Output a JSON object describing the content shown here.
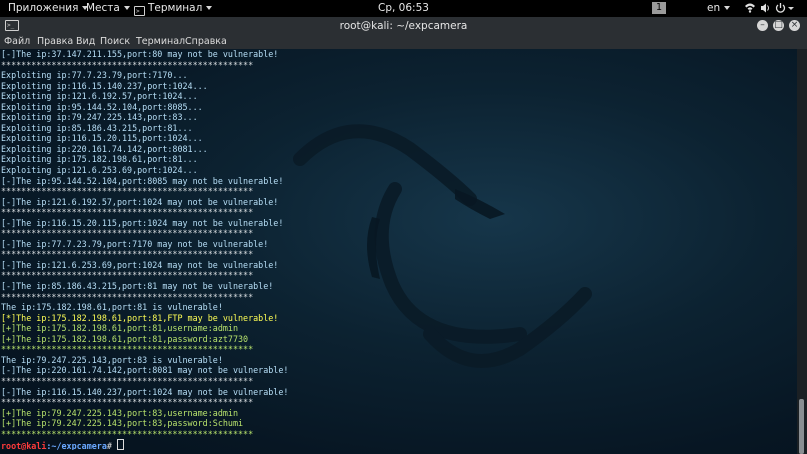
{
  "topbar": {
    "apps": "Приложения",
    "places": "Места",
    "terminal_app": "Терминал",
    "clock": "Ср, 06:53",
    "workspace": "1",
    "language": "en"
  },
  "window": {
    "title": "root@kali: ~/expcamera",
    "menu": [
      "Файл",
      "Правка",
      "Вид",
      "Поиск",
      "Терминал",
      "Справка"
    ]
  },
  "terminal": {
    "lines": [
      {
        "t": "[-]The ip:37.147.211.155,port:80 may not be vulnerable!",
        "c": "b"
      },
      {
        "t": "**************************************************",
        "c": "s"
      },
      {
        "t": "Exploiting ip:77.7.23.79,port:7170...",
        "c": "w"
      },
      {
        "t": "Exploiting ip:116.15.140.237,port:1024...",
        "c": "w"
      },
      {
        "t": "Exploiting ip:121.6.192.57,port:1024...",
        "c": "w"
      },
      {
        "t": "Exploiting ip:95.144.52.104,port:8085...",
        "c": "w"
      },
      {
        "t": "Exploiting ip:79.247.225.143,port:83...",
        "c": "w"
      },
      {
        "t": "Exploiting ip:85.186.43.215,port:81...",
        "c": "w"
      },
      {
        "t": "Exploiting ip:116.15.20.115,port:1024...",
        "c": "w"
      },
      {
        "t": "Exploiting ip:220.161.74.142,port:8081...",
        "c": "w"
      },
      {
        "t": "Exploiting ip:175.182.198.61,port:81...",
        "c": "w"
      },
      {
        "t": "Exploiting ip:121.6.253.69,port:1024...",
        "c": "w"
      },
      {
        "t": "[-]The ip:95.144.52.104,port:8085 may not be vulnerable!",
        "c": "b"
      },
      {
        "t": "**************************************************",
        "c": "s"
      },
      {
        "t": "[-]The ip:121.6.192.57,port:1024 may not be vulnerable!",
        "c": "b"
      },
      {
        "t": "**************************************************",
        "c": "s"
      },
      {
        "t": "[-]The ip:116.15.20.115,port:1024 may not be vulnerable!",
        "c": "b"
      },
      {
        "t": "**************************************************",
        "c": "s"
      },
      {
        "t": "[-]The ip:77.7.23.79,port:7170 may not be vulnerable!",
        "c": "b"
      },
      {
        "t": "**************************************************",
        "c": "s"
      },
      {
        "t": "[-]The ip:121.6.253.69,port:1024 may not be vulnerable!",
        "c": "b"
      },
      {
        "t": "**************************************************",
        "c": "s"
      },
      {
        "t": "[-]The ip:85.186.43.215,port:81 may not be vulnerable!",
        "c": "b"
      },
      {
        "t": "**************************************************",
        "c": "s"
      },
      {
        "t": "The ip:175.182.198.61,port:81 is vulnerable!",
        "c": "w"
      },
      {
        "t": "[*]The ip:175.182.198.61,port:81,FTP may be vulnerable!",
        "c": "y"
      },
      {
        "t": "[+]The ip:175.182.198.61,port:81,username:admin",
        "c": "g"
      },
      {
        "t": "[+]The ip:175.182.198.61,port:81,password:azt7730",
        "c": "g"
      },
      {
        "t": "**************************************************",
        "c": "star"
      },
      {
        "t": "The ip:79.247.225.143,port:83 is vulnerable!",
        "c": "w"
      },
      {
        "t": "[-]The ip:220.161.74.142,port:8081 may not be vulnerable!",
        "c": "b"
      },
      {
        "t": "**************************************************",
        "c": "s"
      },
      {
        "t": "[-]The ip:116.15.140.237,port:1024 may not be vulnerable!",
        "c": "b"
      },
      {
        "t": "**************************************************",
        "c": "s"
      },
      {
        "t": "[+]The ip:79.247.225.143,port:83,username:admin",
        "c": "g"
      },
      {
        "t": "[+]The ip:79.247.225.143,port:83,password:Schumi",
        "c": "g"
      },
      {
        "t": "**************************************************",
        "c": "star"
      }
    ],
    "prompt_user": "root@kali",
    "prompt_path": ":~/expcamera",
    "prompt_symbol": "# "
  },
  "colors": {
    "info": "#b7dff7",
    "warning": "#ffff55",
    "success": "#b8e36c",
    "prompt_user": "#ff3b3b",
    "prompt_path": "#6aa8ff"
  },
  "icons": [
    "terminal-icon",
    "dropdown-arrow-icon",
    "wifi-icon",
    "sound-icon",
    "power-icon",
    "minimize-icon",
    "maximize-icon",
    "close-icon",
    "kali-dragon-watermark"
  ]
}
